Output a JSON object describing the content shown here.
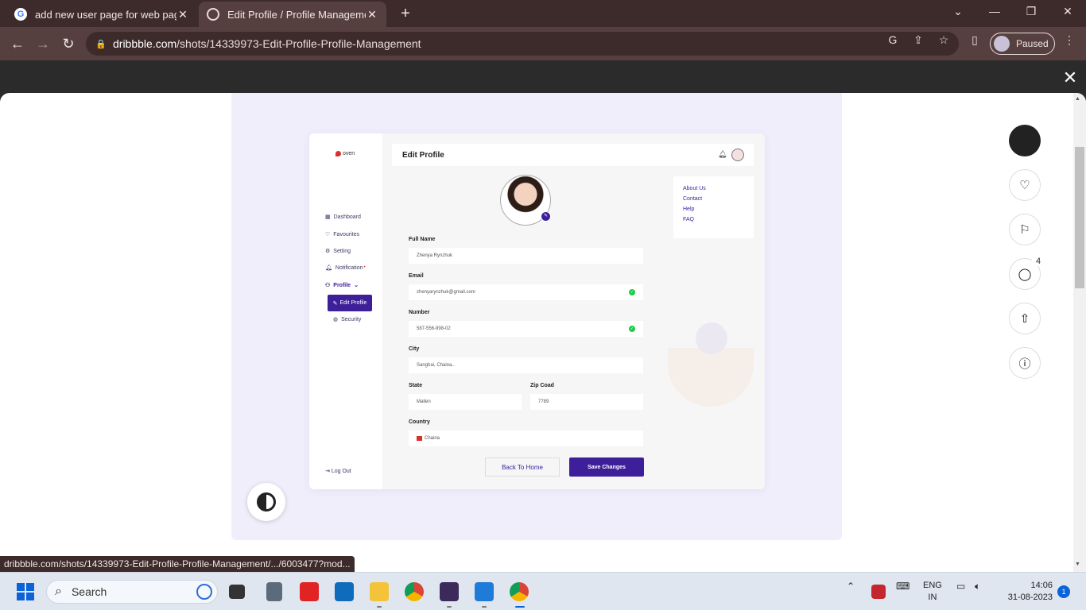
{
  "browser": {
    "tabs": [
      {
        "title": "add new user page for web page",
        "active": false,
        "icon": "google-icon"
      },
      {
        "title": "Edit Profile / Profile Management",
        "active": true,
        "icon": "dribbble-icon"
      }
    ],
    "url_domain": "dribbble.com",
    "url_path": "/shots/14339973-Edit-Profile-Profile-Management",
    "profile_status": "Paused",
    "status_url": "dribbble.com/shots/14339973-Edit-Profile-Profile-Management/.../6003477?mod..."
  },
  "shot": {
    "logo": "oven",
    "title": "Edit Profile",
    "sidebar": [
      {
        "label": "Dashboard",
        "icon": "grid-icon"
      },
      {
        "label": "Favourites",
        "icon": "heart-icon"
      },
      {
        "label": "Setting",
        "icon": "gear-icon"
      },
      {
        "label": "Notification",
        "icon": "bell-icon"
      },
      {
        "label": "Profile",
        "icon": "user-icon"
      },
      {
        "label": "Edit Profile",
        "icon": "user-edit-icon"
      },
      {
        "label": "Security",
        "icon": "shield-icon"
      }
    ],
    "logout": "Log Out",
    "fields": {
      "full_name": {
        "label": "Full Name",
        "value": "Zhenya Rynzhuk"
      },
      "email": {
        "label": "Email",
        "value": "zhenyarynzhuk@gmail.com"
      },
      "number": {
        "label": "Number",
        "value": "587-556-998-02"
      },
      "city": {
        "label": "City",
        "value": "Sanghai, Chaina.."
      },
      "state": {
        "label": "State",
        "value": "Mallen"
      },
      "zip": {
        "label": "Zip Coad",
        "value": "7789"
      },
      "country": {
        "label": "Country",
        "value": "Chaina"
      }
    },
    "links": [
      "About Us",
      "Contact",
      "Help",
      "FAQ"
    ],
    "back_button": "Back To Home",
    "save_button": "Save Changes",
    "accent_color": "#3d1f9a"
  },
  "right_rail": {
    "comment_count": "4"
  },
  "taskbar": {
    "search_placeholder": "Search",
    "lang_1": "ENG",
    "lang_2": "IN",
    "time": "14:06",
    "date": "31-08-2023",
    "notification_count": "1"
  }
}
